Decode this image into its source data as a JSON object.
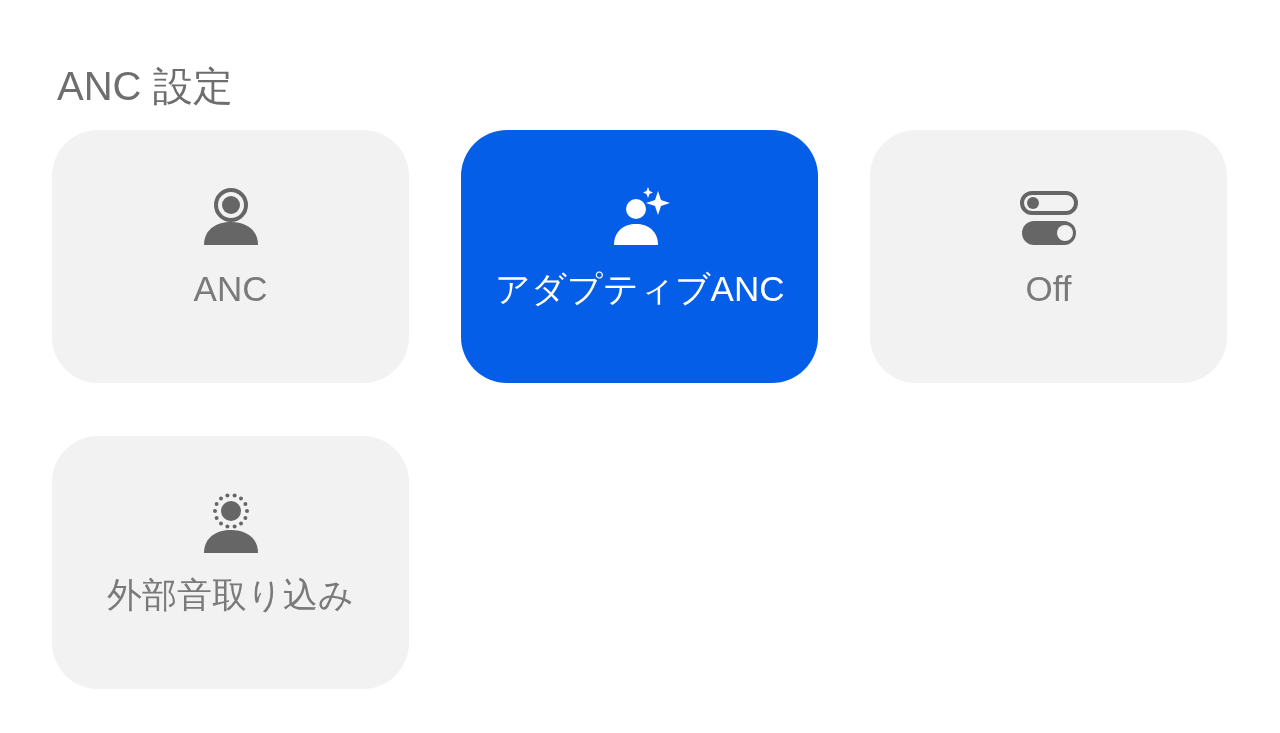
{
  "title": "ANC 設定",
  "options": [
    {
      "label": "ANC",
      "kind": "anc",
      "selected": false
    },
    {
      "label": "アダプティブANC",
      "kind": "adaptive",
      "selected": true
    },
    {
      "label": "Off",
      "kind": "off",
      "selected": false
    },
    {
      "label": "外部音取り込み",
      "kind": "transparency",
      "selected": false
    }
  ]
}
